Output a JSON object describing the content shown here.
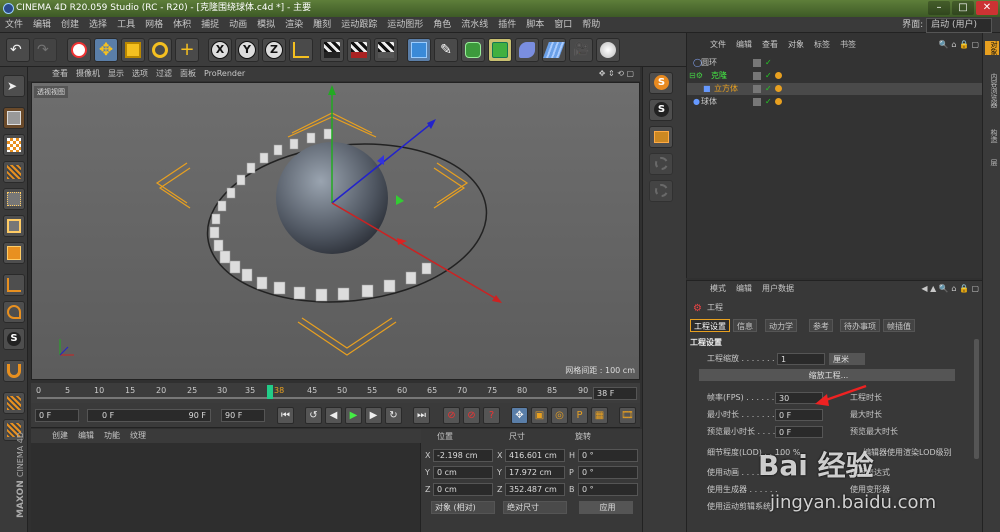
{
  "titlebar": {
    "title": "CINEMA 4D R20.059 Studio (RC - R20) - [克隆围绕球体.c4d *] - 主要"
  },
  "menubar": {
    "items": [
      "文件",
      "编辑",
      "创建",
      "选择",
      "工具",
      "网格",
      "体积",
      "捕捉",
      "动画",
      "模拟",
      "渲染",
      "雕刻",
      "运动跟踪",
      "运动图形",
      "角色",
      "流水线",
      "插件",
      "脚本",
      "窗口",
      "帮助"
    ],
    "layout_label": "界面:",
    "layout_value": "启动 (用户)"
  },
  "toolbar": {
    "x_label": "X",
    "y_label": "Y",
    "z_label": "Z"
  },
  "viewport": {
    "menu": [
      "查看",
      "摄像机",
      "显示",
      "选项",
      "过滤",
      "面板",
      "ProRender"
    ],
    "label": "透视视图",
    "grid_info": "网格间距 : 100 cm"
  },
  "objects": {
    "menu": [
      "文件",
      "编辑",
      "查看",
      "对象",
      "标签",
      "书签"
    ],
    "rows": [
      {
        "name": "圆环"
      },
      {
        "name": "克隆"
      },
      {
        "name": "立方体"
      },
      {
        "name": "球体"
      }
    ]
  },
  "side_tabs": [
    "对象",
    "内容浏览器",
    "构造",
    "层"
  ],
  "attributes": {
    "menu": [
      "模式",
      "编辑",
      "用户数据"
    ],
    "header": "工程",
    "tabs": [
      "工程设置",
      "信息",
      "动力学",
      "参考",
      "待办事项",
      "帧插值"
    ],
    "section": "工程设置",
    "scale_label": "工程缩放 . . . . . . .",
    "scale_value": "1",
    "scale_unit": "厘米",
    "scale_button": "缩放工程...",
    "fps_label": "帧率(FPS) . . . . . .",
    "fps_value": "30",
    "project_time_label": "工程时长",
    "min_time_label": "最小时长 . . . . . . . .",
    "min_time_value": "0 F",
    "max_time_label": "最大时长",
    "preview_min_label": "预览最小时长 . . . .",
    "preview_min_value": "0 F",
    "preview_max_label": "预览最大时长",
    "lod_label": "细节程度(LOD) . . . .",
    "lod_value": "100 %",
    "render_lod_label": "编辑器使用渲染LOD级别",
    "use_anim_label": "使用动画 . . . . . . .",
    "use_expr_label": "使用表达式",
    "use_gen_label": "使用生成器 . . . . . .",
    "use_deform_label": "使用变形器",
    "use_motion_label": "使用运动剪辑系统"
  },
  "timeline": {
    "ticks": [
      "0",
      "5",
      "10",
      "15",
      "20",
      "25",
      "30",
      "35",
      "40",
      "45",
      "50",
      "55",
      "60",
      "65",
      "70",
      "75",
      "80",
      "85",
      "90"
    ],
    "current_frame": "38",
    "frame_field": "38 F"
  },
  "playback": {
    "start": "0 F",
    "min": "0 F",
    "max": "90 F",
    "end": "90 F"
  },
  "materials": {
    "menu": [
      "创建",
      "编辑",
      "功能",
      "纹理"
    ]
  },
  "coordinates": {
    "headers": [
      "位置",
      "尺寸",
      "旋转"
    ],
    "position": {
      "x": "-2.198 cm",
      "y": "0 cm",
      "z": "0 cm"
    },
    "size": {
      "x": "416.601 cm",
      "y": "17.972 cm",
      "z": "352.487 cm"
    },
    "rotation": {
      "h": "0 °",
      "p": "0 °",
      "b": "0 °"
    },
    "axis_labels": {
      "x": "X",
      "y": "Y",
      "z": "Z",
      "h": "H",
      "p": "P",
      "b": "B"
    },
    "mode_dropdown": "对象 (相对)",
    "size_dropdown": "绝对尺寸",
    "apply_button": "应用"
  },
  "branding": {
    "maxon": "MAXON",
    "c4d": "CINEMA 4D"
  },
  "watermark": {
    "brand": "Bai 经验",
    "url": "jingyan.baidu.com"
  }
}
